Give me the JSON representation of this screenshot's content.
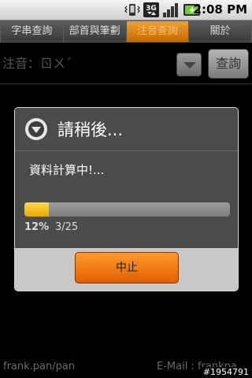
{
  "status_bar": {
    "time": "2:08",
    "time_suffix": "PM",
    "network_label": "3G",
    "icons": [
      "vibrate-icon",
      "3g-network-icon",
      "signal-strength-icon",
      "battery-charging-icon"
    ]
  },
  "tabs": [
    {
      "label": "字串查詢"
    },
    {
      "label": "部首與筆劃"
    },
    {
      "label": "注音查詢",
      "active": true
    },
    {
      "label": "關於"
    }
  ],
  "main": {
    "zhuyin_label": "注音：ㄖㄨˊ",
    "query_button": "查詢"
  },
  "footer": {
    "left": "frank.pan/pan",
    "right": "E-Mail : frankpa"
  },
  "watermark": "#1954791",
  "dialog": {
    "title": "請稍後...",
    "message": "資料計算中!...",
    "progress_fraction": 0.12,
    "progress_percent": "12%",
    "progress_count": "3/25",
    "stop_button": "中止"
  },
  "colors": {
    "accent_orange": "#e57200",
    "progress_yellow": "#f2bd14",
    "dialog_bg": "#4b4b4b"
  }
}
